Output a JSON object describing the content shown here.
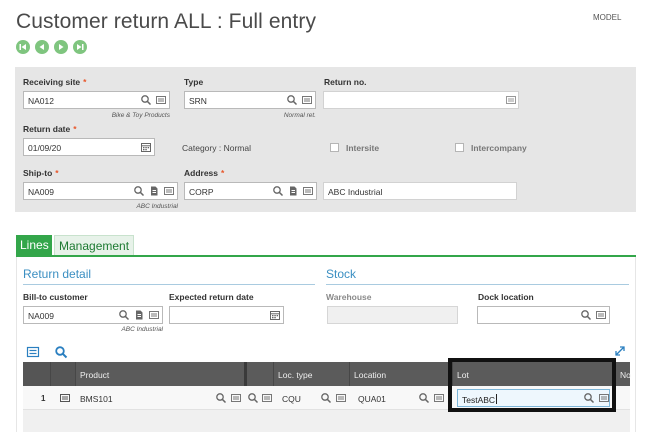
{
  "page": {
    "title": "Customer return ALL : Full entry",
    "model_label": "MODEL"
  },
  "nav": {
    "icons": [
      "first-record-icon",
      "previous-record-icon",
      "next-record-icon",
      "last-record-icon"
    ]
  },
  "header": {
    "receiving_site": {
      "label": "Receiving site",
      "value": "NA012",
      "description": "Bike & Toy Products"
    },
    "type": {
      "label": "Type",
      "value": "SRN",
      "description": "Normal ret."
    },
    "return_no": {
      "label": "Return no.",
      "value": ""
    },
    "return_date": {
      "label": "Return date",
      "value": "01/09/20"
    },
    "category": {
      "text": "Category : Normal"
    },
    "intersite": {
      "label": "Intersite",
      "checked": false
    },
    "intercompany": {
      "label": "Intercompany",
      "checked": false
    },
    "ship_to": {
      "label": "Ship-to",
      "value": "NA009",
      "description": "ABC Industrial"
    },
    "address": {
      "label": "Address",
      "value": "CORP",
      "name": "ABC Industrial"
    },
    "required_marker": "*"
  },
  "tabs": [
    {
      "label": "Lines",
      "active": true
    },
    {
      "label": "Management",
      "active": false
    }
  ],
  "lines": {
    "return_detail_title": "Return detail",
    "stock_title": "Stock",
    "bill_to_customer": {
      "label": "Bill-to customer",
      "value": "NA009",
      "description": "ABC Industrial"
    },
    "expected_return_date": {
      "label": "Expected return date",
      "value": ""
    },
    "warehouse": {
      "label": "Warehouse",
      "value": ""
    },
    "dock_location": {
      "label": "Dock location",
      "value": ""
    }
  },
  "grid": {
    "columns": [
      "Product",
      "Loc. type",
      "Location",
      "Lot",
      "No"
    ],
    "rows": [
      {
        "line": "1",
        "product": "BMS101",
        "loc_type": "CQU",
        "location": "QUA01",
        "lot": "TestABC"
      }
    ]
  },
  "colors": {
    "accent_green": "#33a64a",
    "section_blue": "#3b8fc2",
    "required_orange": "#e8572b",
    "grid_header": "#5b5b5b"
  }
}
